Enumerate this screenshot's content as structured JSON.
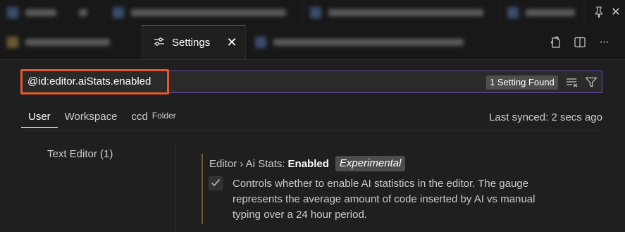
{
  "top_strip": {
    "pin_icon": "pin-icon",
    "close_icon": "close-icon"
  },
  "editor_tabs": {
    "active_tab": {
      "label": "Settings",
      "icon": "settings-sliders-icon",
      "close_glyph": "✕"
    },
    "actions": [
      "open-json-icon",
      "split-editor-icon",
      "more-actions-icon"
    ],
    "more_glyph": "···"
  },
  "search": {
    "value": "@id:editor.aiStats.enabled",
    "results_badge": "1 Setting Found",
    "clear_filter_icon": "clear-search-icon",
    "filter_icon": "filter-icon"
  },
  "scopes": {
    "tabs": [
      {
        "label": "User",
        "active": true
      },
      {
        "label": "Workspace",
        "active": false
      },
      {
        "label": "ccd",
        "sublabel": "Folder",
        "active": false
      }
    ],
    "last_synced": "Last synced: 2 secs ago"
  },
  "toc": {
    "items": [
      {
        "label": "Text Editor (1)"
      }
    ]
  },
  "setting": {
    "category": "Editor › Ai Stats:",
    "name": "Enabled",
    "tag": "Experimental",
    "checked": true,
    "description": "Controls whether to enable AI statistics in the editor. The gauge represents the average amount of code inserted by AI vs manual typing over a 24 hour period."
  },
  "colors": {
    "accent": "#6a4ba7",
    "highlight_box": "#e8572a",
    "background": "#1f1f1f"
  }
}
